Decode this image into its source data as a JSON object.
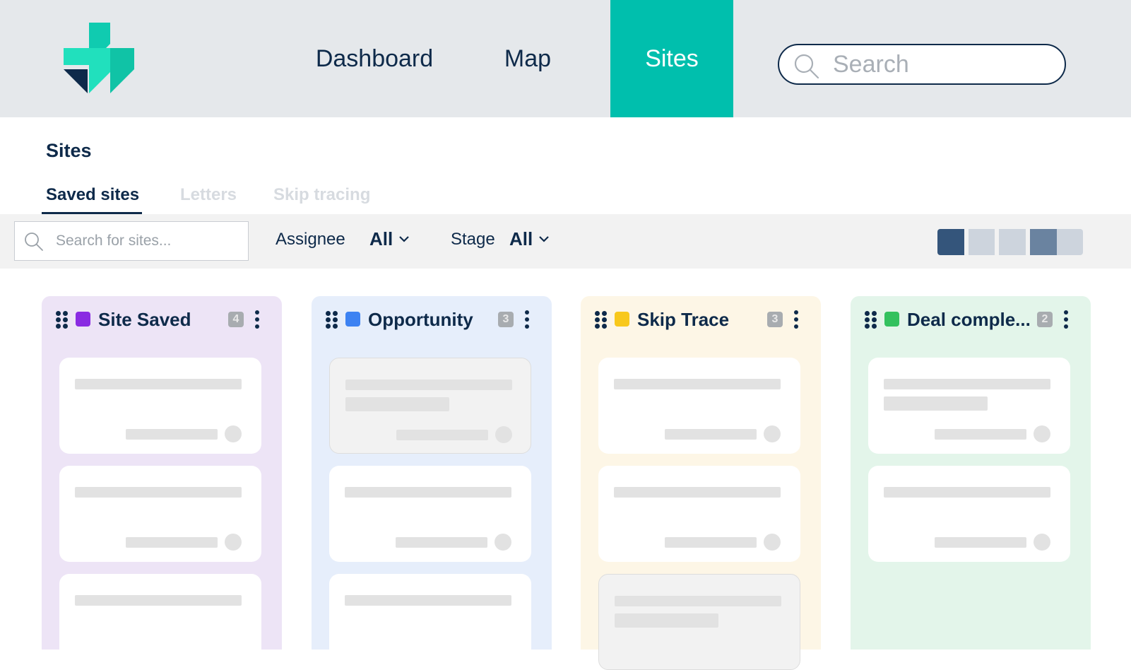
{
  "colors": {
    "nav_active_bg": "#00bfad",
    "topbar_bg": "#e5e8eb",
    "text_dark": "#0e2a4a"
  },
  "brand": {
    "logo_icon": "brand-logo-icon"
  },
  "nav": {
    "dashboard": "Dashboard",
    "map": "Map",
    "sites": "Sites",
    "active": "Sites",
    "search_placeholder": "Search"
  },
  "page": {
    "title": "Sites",
    "tabs": [
      {
        "label": "Saved sites",
        "active": true
      },
      {
        "label": "Letters",
        "active": false
      },
      {
        "label": "Skip tracing",
        "active": false
      }
    ]
  },
  "filters": {
    "search_placeholder": "Search for sites...",
    "assignee_label": "Assignee",
    "assignee_value": "All",
    "stage_label": "Stage",
    "stage_value": "All",
    "view_toggle_icons": [
      "view-board-icon",
      "view-list-icon",
      "view-compact-icon",
      "view-split-icon"
    ]
  },
  "board": {
    "columns": [
      {
        "title": "Site Saved",
        "count": "4",
        "color": "#8a2be2",
        "bg": "#ede4f6"
      },
      {
        "title": "Opportunity",
        "count": "3",
        "color": "#3d82f2",
        "bg": "#e6eefb"
      },
      {
        "title": "Skip Trace",
        "count": "3",
        "color": "#f8c81c",
        "bg": "#fdf6e6"
      },
      {
        "title": "Deal comple...",
        "count": "2",
        "color": "#33c15e",
        "bg": "#e3f5ea"
      }
    ]
  }
}
